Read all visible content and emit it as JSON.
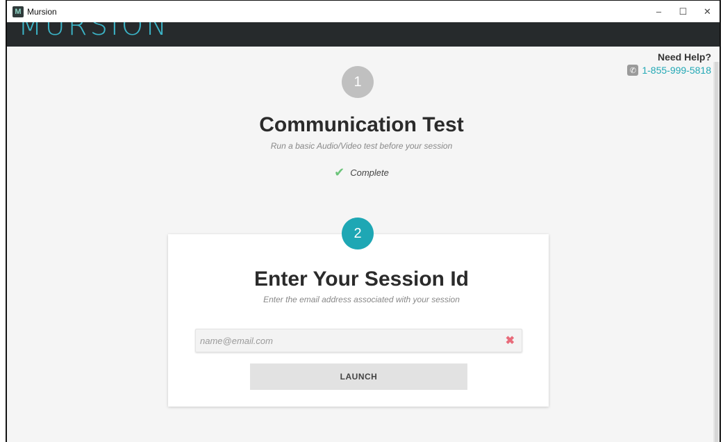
{
  "window": {
    "title": "Mursion",
    "icon": "mursion-app-icon",
    "controls": {
      "minimize": "–",
      "maximize": "☐",
      "close": "✕"
    }
  },
  "header": {
    "brand": "MURSION"
  },
  "help": {
    "title": "Need Help?",
    "phone": "1-855-999-5818",
    "phone_icon": "phone-icon"
  },
  "step1": {
    "number": "1",
    "title": "Communication Test",
    "subtitle": "Run a basic Audio/Video test before your session",
    "status": "Complete",
    "status_icon": "check-icon"
  },
  "step2": {
    "number": "2",
    "title": "Enter Your Session Id",
    "subtitle": "Enter the email address associated with your session",
    "input_placeholder": "name@email.com",
    "input_value": "",
    "clear_icon": "close-icon",
    "button_label": "LAUNCH"
  },
  "colors": {
    "accent": "#1ea7b4",
    "step_inactive": "#c0c0c0",
    "check": "#6cc47a",
    "clear": "#e86b7a",
    "header_bg": "#262a2c"
  }
}
